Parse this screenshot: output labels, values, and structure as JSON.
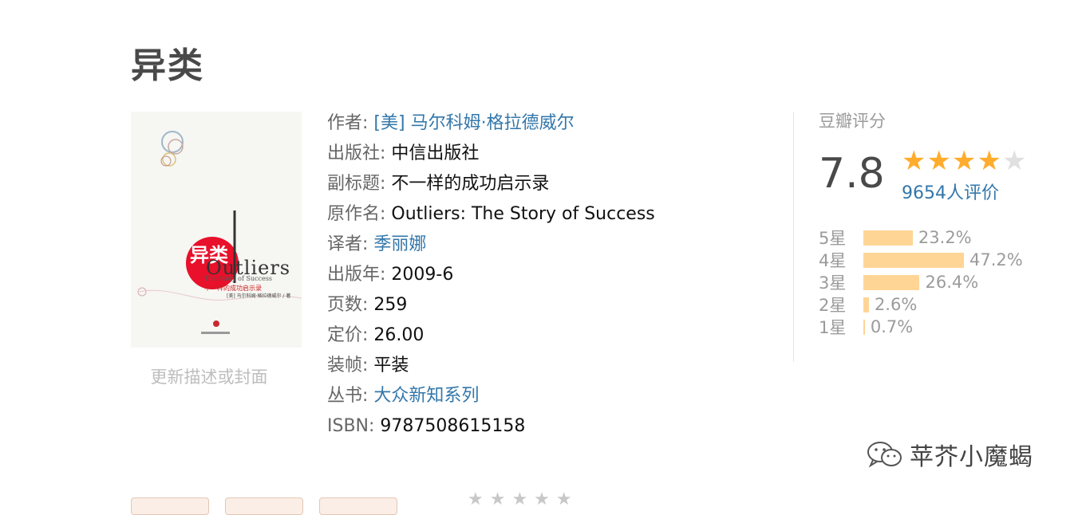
{
  "book": {
    "title": "异类",
    "cover": {
      "title_cn": "异类",
      "title_en": "Outliers",
      "subtitle_en": "The Story of Success",
      "subtitle_cn": "不一样的成功启示录",
      "author_line": "[美] 马尔科姆·格拉德威尔 / 著"
    },
    "update_link": "更新描述或封面"
  },
  "info": {
    "author": {
      "label": "作者:",
      "value": "[美] 马尔科姆·格拉德威尔"
    },
    "publisher": {
      "label": "出版社:",
      "value": "中信出版社"
    },
    "subtitle": {
      "label": "副标题:",
      "value": "不一样的成功启示录"
    },
    "original": {
      "label": "原作名:",
      "value": "Outliers: The Story of Success"
    },
    "translator": {
      "label": "译者:",
      "value": "季丽娜"
    },
    "year": {
      "label": "出版年:",
      "value": "2009-6"
    },
    "pages": {
      "label": "页数:",
      "value": "259"
    },
    "price": {
      "label": "定价:",
      "value": "26.00"
    },
    "binding": {
      "label": "装帧:",
      "value": "平装"
    },
    "series": {
      "label": "丛书:",
      "value": "大众新知系列"
    },
    "isbn": {
      "label": "ISBN:",
      "value": "9787508615158"
    }
  },
  "rating": {
    "title": "豆瓣评分",
    "score": "7.8",
    "stars_filled": 4,
    "stars_total": 5,
    "people": "9654人评价",
    "distribution": [
      {
        "label": "5星",
        "percent": "23.2%",
        "value": 23.2
      },
      {
        "label": "4星",
        "percent": "47.2%",
        "value": 47.2
      },
      {
        "label": "3星",
        "percent": "26.4%",
        "value": 26.4
      },
      {
        "label": "2星",
        "percent": "2.6%",
        "value": 2.6
      },
      {
        "label": "1星",
        "percent": "0.7%",
        "value": 0.7
      }
    ]
  },
  "watermark": {
    "text": "苹芥小魔蝎",
    "icon": "wechat-icon"
  },
  "colors": {
    "link": "#3377aa",
    "star": "#ffac2d",
    "bar": "#ffd596"
  }
}
